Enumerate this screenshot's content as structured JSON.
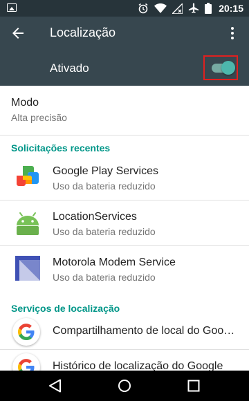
{
  "status_bar": {
    "time": "20:15",
    "icons": [
      "image-notification-icon",
      "alarm-icon",
      "wifi-icon",
      "no-signal-icon",
      "airplane-icon",
      "battery-icon"
    ]
  },
  "toolbar": {
    "title": "Localização",
    "back_icon": "arrow-back-icon",
    "menu_icon": "more-vert-icon"
  },
  "master_switch": {
    "label": "Ativado",
    "state": "on",
    "accent_color": "#4db6ac",
    "highlight_color": "#e0201f"
  },
  "mode": {
    "title": "Modo",
    "value": "Alta precisão"
  },
  "recent_requests": {
    "header": "Solicitações recentes",
    "items": [
      {
        "name": "Google Play Services",
        "detail": "Uso da bateria reduzido",
        "icon": "google-play-services-icon"
      },
      {
        "name": "LocationServices",
        "detail": "Uso da bateria reduzido",
        "icon": "android-icon"
      },
      {
        "name": "Motorola Modem Service",
        "detail": "Uso da bateria reduzido",
        "icon": "motorola-modem-icon"
      }
    ]
  },
  "location_services": {
    "header": "Serviços de localização",
    "items": [
      {
        "name": "Compartilhamento de local do Googl...",
        "icon": "google-g-icon"
      },
      {
        "name": "Histórico de localização do Google",
        "icon": "google-g-icon"
      }
    ]
  },
  "nav_bar": {
    "icons": [
      "nav-back-icon",
      "nav-home-icon",
      "nav-recents-icon"
    ]
  }
}
